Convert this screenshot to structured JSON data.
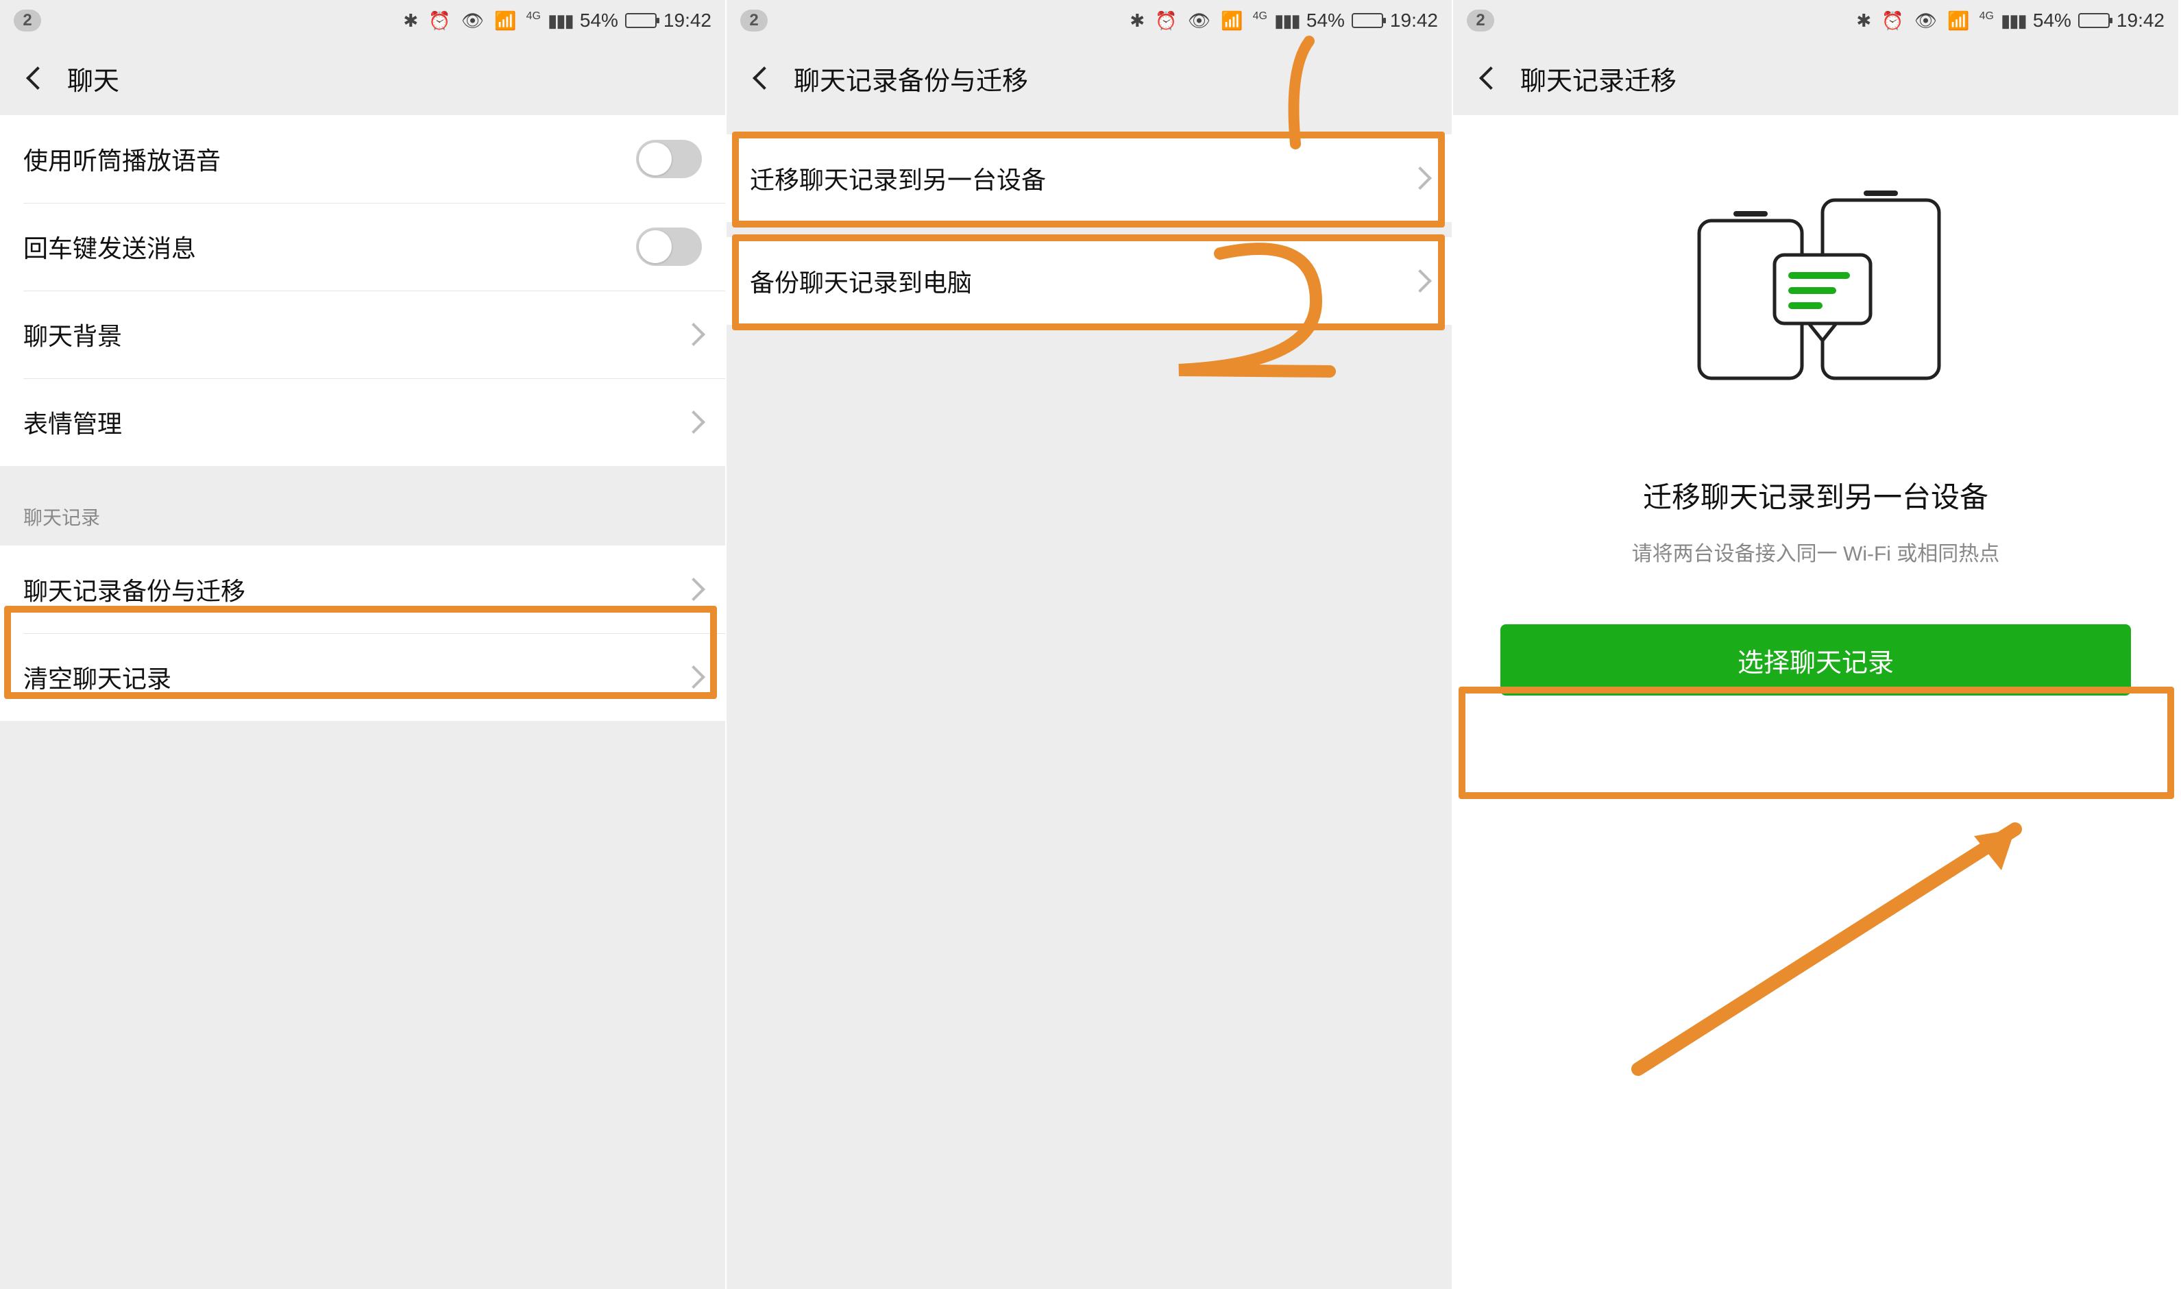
{
  "status": {
    "notif_count": "2",
    "battery_pct": "54%",
    "battery_fill": "54%",
    "time": "19:42"
  },
  "screen1": {
    "title": "聊天",
    "rows": {
      "earpiece": "使用听筒播放语音",
      "enter_send": "回车键发送消息",
      "background": "聊天背景",
      "sticker": "表情管理",
      "section": "聊天记录",
      "backup": "聊天记录备份与迁移",
      "clear": "清空聊天记录"
    }
  },
  "screen2": {
    "title": "聊天记录备份与迁移",
    "rows": {
      "migrate": "迁移聊天记录到另一台设备",
      "backup_pc": "备份聊天记录到电脑"
    }
  },
  "screen3": {
    "title": "聊天记录迁移",
    "headline": "迁移聊天记录到另一台设备",
    "sub": "请将两台设备接入同一 Wi-Fi 或相同热点",
    "button": "选择聊天记录"
  }
}
